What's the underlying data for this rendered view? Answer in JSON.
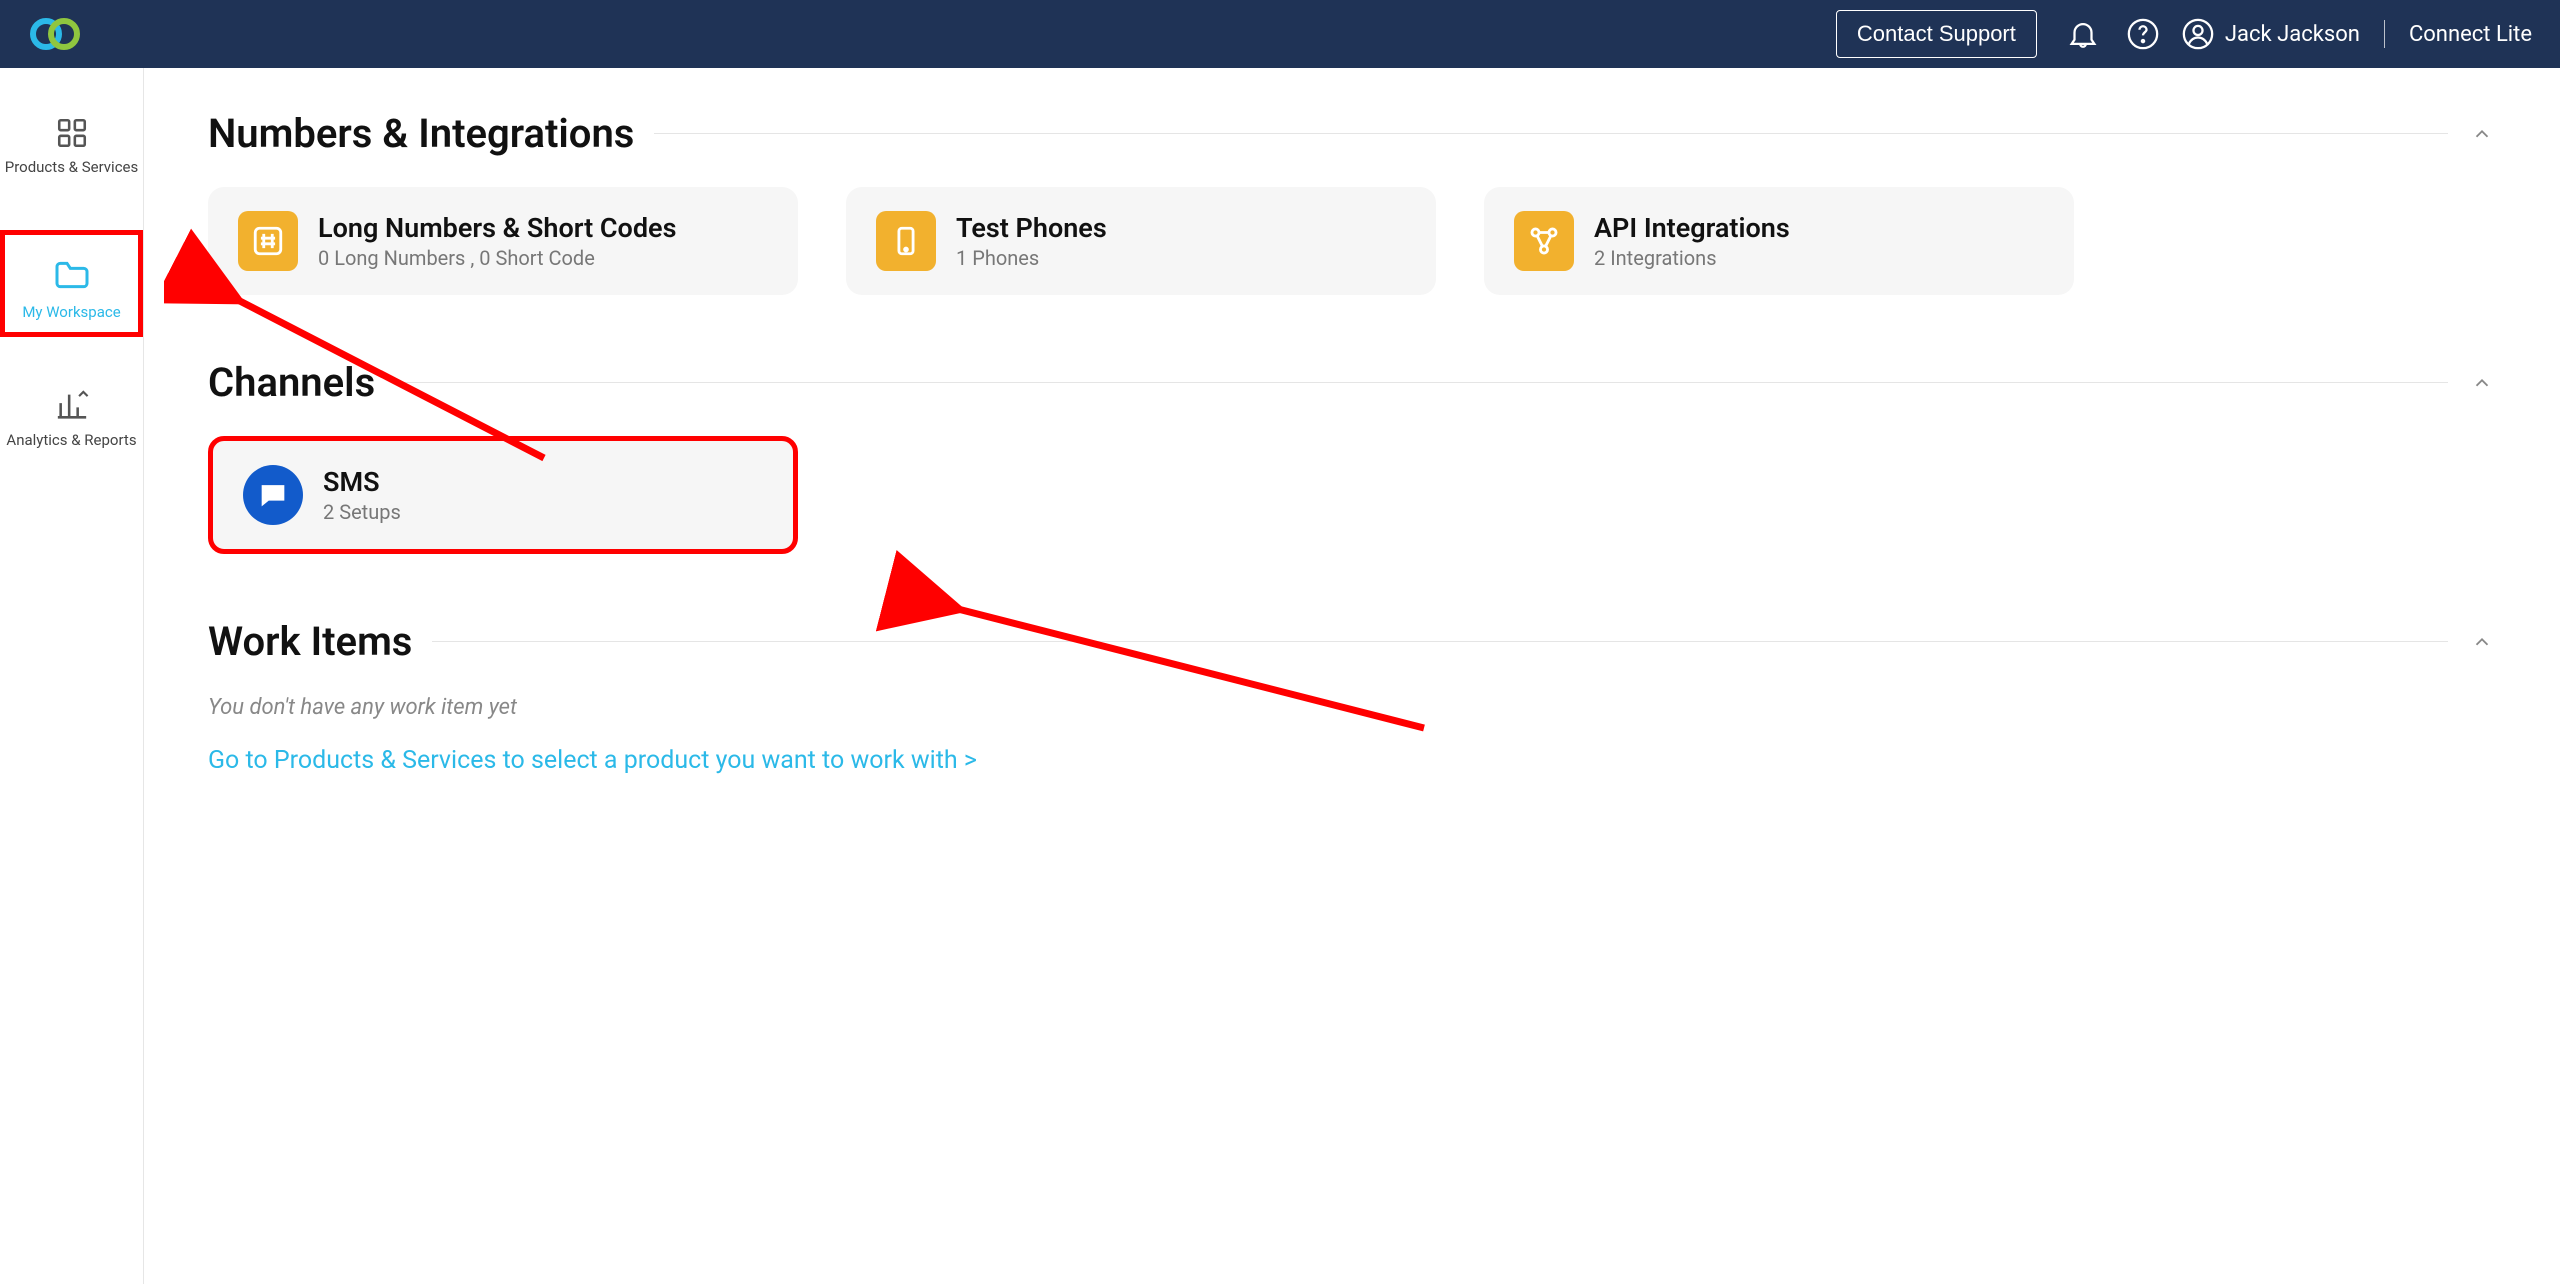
{
  "header": {
    "contact_label": "Contact Support",
    "user_name": "Jack Jackson",
    "plan_name": "Connect Lite"
  },
  "sidebar": {
    "items": [
      {
        "label": "Products & Services"
      },
      {
        "label": "My Workspace"
      },
      {
        "label": "Analytics & Reports"
      }
    ]
  },
  "sections": {
    "numbers": {
      "title": "Numbers & Integrations",
      "cards": [
        {
          "title": "Long Numbers & Short Codes",
          "sub": "0 Long Numbers ,  0 Short Code"
        },
        {
          "title": "Test Phones",
          "sub": "1 Phones"
        },
        {
          "title": "API Integrations",
          "sub": "2 Integrations"
        }
      ]
    },
    "channels": {
      "title": "Channels",
      "cards": [
        {
          "title": "SMS",
          "sub": "2 Setups"
        }
      ]
    },
    "workitems": {
      "title": "Work Items",
      "empty": "You don't have any work item yet",
      "link": "Go to Products & Services to select a product you want to work with >"
    }
  }
}
